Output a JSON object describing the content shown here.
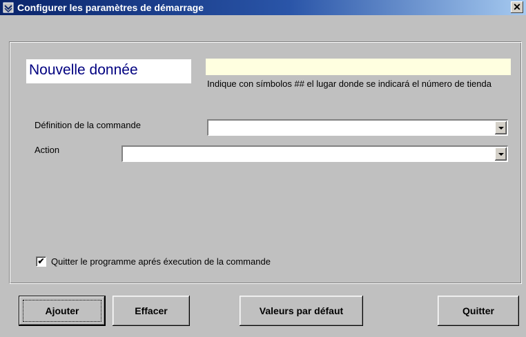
{
  "window": {
    "title": "Configurer les paramètres de démarrage",
    "close_glyph": "✕"
  },
  "form": {
    "new_data_label": "Nouvelle donnée",
    "new_data_value": "",
    "hint": "Indique con símbolos ## el lugar donde se indicará el número de tienda",
    "command_definition_label": "Définition de la commande",
    "command_definition_value": "",
    "action_label": "Action",
    "action_value": "",
    "quit_after_label": "Quitter le programme aprés éxecution de la commande",
    "quit_after_checked": true,
    "checkmark": "✔"
  },
  "buttons": {
    "add": "Ajouter",
    "clear": "Effacer",
    "defaults": "Valeurs par défaut",
    "quit": "Quitter"
  },
  "colors": {
    "titlebar_start": "#0a246a",
    "label_text": "#000080",
    "field_highlight": "#ffffe0",
    "dialog_bg": "#c0c0c0"
  }
}
